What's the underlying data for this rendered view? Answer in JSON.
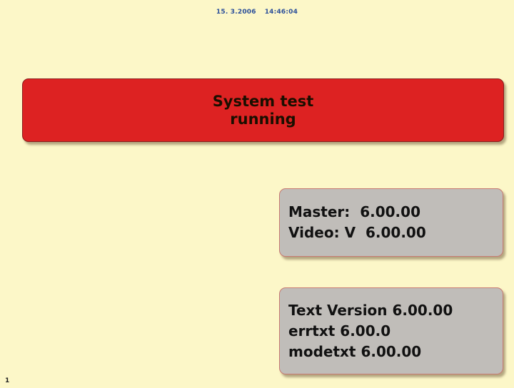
{
  "header": {
    "date": "15. 3.2006",
    "time": "14:46:04"
  },
  "status": {
    "line1": "System test",
    "line2": "running"
  },
  "versions": {
    "master": "Master:  6.00.00",
    "video": "Video: V  6.00.00"
  },
  "texts": {
    "text_version": "Text Version 6.00.00",
    "errtxt": "errtxt 6.00.0",
    "modetxt": "modetxt 6.00.00"
  },
  "footer": {
    "page_index": "1"
  }
}
